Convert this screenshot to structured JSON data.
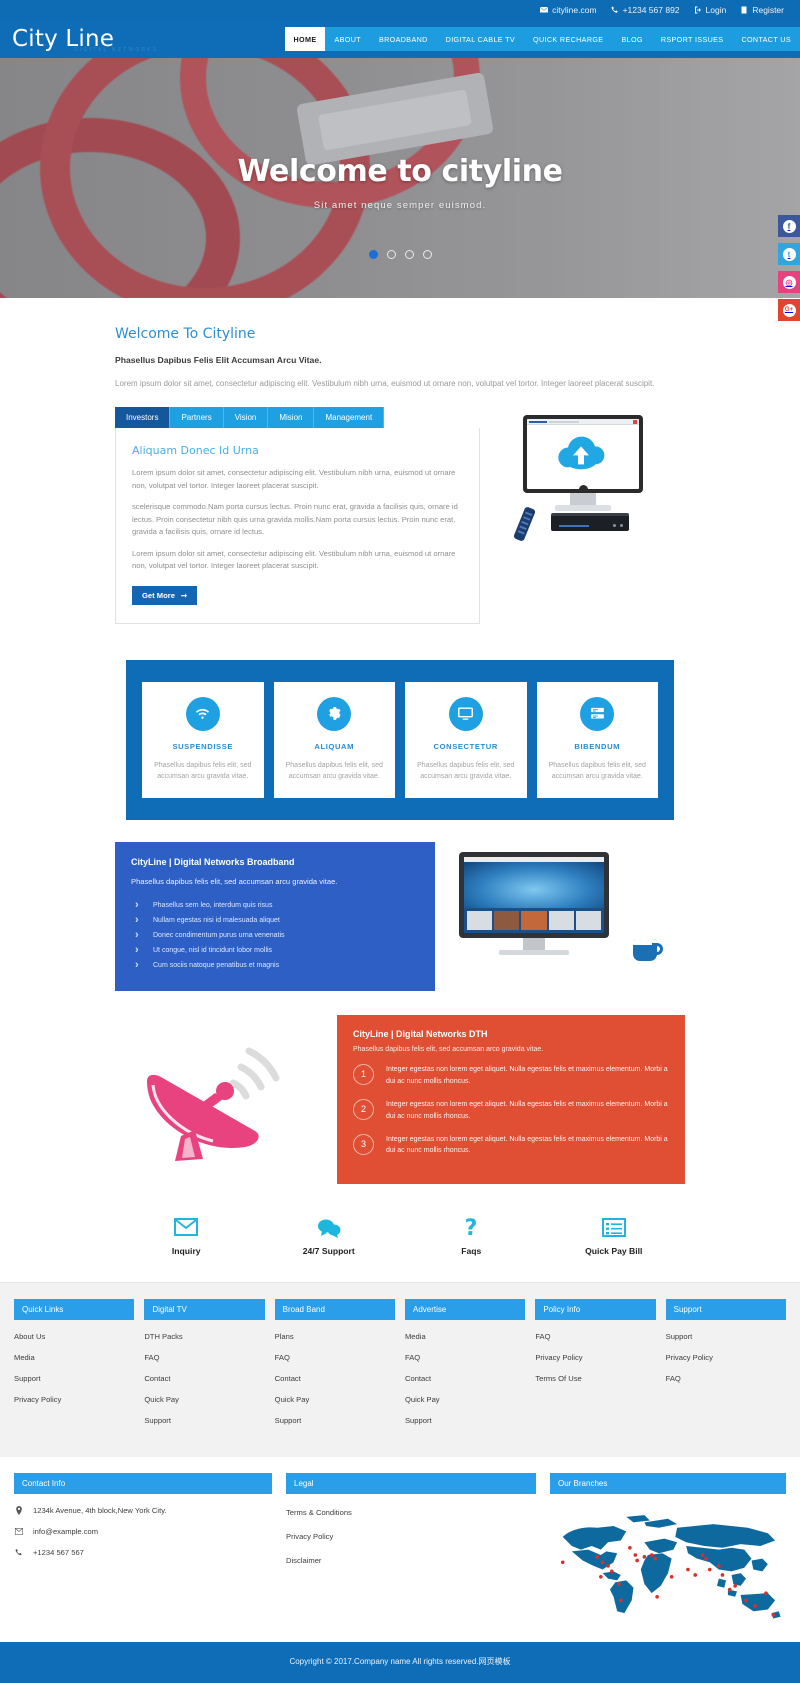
{
  "topbar": {
    "email": "cityline.com",
    "phone": "+1234 567 892",
    "login": "Login",
    "register": "Register"
  },
  "header": {
    "logo": "City Line",
    "logo_sub": "DIGITAL NETWORKS",
    "nav": [
      {
        "label": "HOME",
        "active": true
      },
      {
        "label": "ABOUT",
        "active": false
      },
      {
        "label": "BROADBAND",
        "active": false
      },
      {
        "label": "DIGITAL CABLE TV",
        "active": false
      },
      {
        "label": "QUICK RECHARGE",
        "active": false
      },
      {
        "label": "BLOG",
        "active": false
      },
      {
        "label": "RSPORT ISSUES",
        "active": false
      },
      {
        "label": "CONTACT US",
        "active": false
      }
    ]
  },
  "hero": {
    "title": "Welcome to cityline",
    "subtitle": "Sit amet neque semper euismod.",
    "dots": 4,
    "active_dot": 0
  },
  "social": [
    {
      "name": "facebook",
      "glyph": "f",
      "color": "#3a589b"
    },
    {
      "name": "twitter",
      "glyph": "t",
      "color": "#30a5e0"
    },
    {
      "name": "instagram",
      "glyph": "◎",
      "color": "#e8427e"
    },
    {
      "name": "googleplus",
      "glyph": "G+",
      "color": "#e2452f"
    }
  ],
  "welcome": {
    "heading": "Welcome To Cityline",
    "lead": "Phasellus Dapibus Felis Elit Accumsan Arcu Vitae.",
    "paragraph": "Lorem ipsum dolor sit amet, consectetur adipiscing elit. Vestibulum nibh urna, euismod ut ornare non, volutpat vel tortor. Integer laoreet placerat suscipit.",
    "tabs": [
      {
        "label": "Investors",
        "active": true
      },
      {
        "label": "Partners",
        "active": false
      },
      {
        "label": "Vision",
        "active": false
      },
      {
        "label": "Mision",
        "active": false
      },
      {
        "label": "Management",
        "active": false
      }
    ],
    "panel": {
      "title": "Aliquam Donec Id Urna",
      "p1": "Lorem ipsum dolor sit amet, consectetur adipiscing elit. Vestibulum nibh urna, euismod ut ornare non, volutpat vel tortor. Integer laoreet placerat suscipit.",
      "p2": "scelerisque commodo.Nam porta cursus lectus. Proin nunc erat, gravida a facilisis quis, ornare id lectus. Proin consectetur nibh quis urna gravida mollis.Nam porta cursus lectus. Proin nunc erat, gravida a facilisis quis, ornare id lectus.",
      "p3": "Lorem ipsum dolor sit amet, consectetur adipiscing elit. Vestibulum nibh urna, euismod ut ornare non, volutpat vel tortor. Integer laoreet placerat suscipit.",
      "button": "Get More"
    }
  },
  "services": [
    {
      "icon": "wifi-icon",
      "title": "SUSPENDISSE",
      "text": "Phasellus dapibus felis elit, sed accumsan arcu gravida vitae."
    },
    {
      "icon": "gear-icon",
      "title": "ALIQUAM",
      "text": "Phasellus dapibus felis elit, sed accumsan arcu gravida vitae."
    },
    {
      "icon": "monitor-icon",
      "title": "CONSECTETUR",
      "text": "Phasellus dapibus felis elit, sed accumsan arcu gravida vitae."
    },
    {
      "icon": "server-icon",
      "title": "BIBENDUM",
      "text": "Phasellus dapibus felis elit, sed accumsan arcu gravida vitae."
    }
  ],
  "broadband": {
    "title": "CityLine | Digital Networks Broadband",
    "subtitle": "Phasellus dapibus felis elit, sed accumsan arcu gravida vitae.",
    "items": [
      "Phasellus sem leo, interdum quis risus",
      "Nullam egestas nisi id malesuada aliquet",
      "Donec condimentum purus urna venenatis",
      "Ut congue, nisl id tincidunt lobor mollis",
      "Cum sociis natoque penatibus et magnis"
    ]
  },
  "dth": {
    "title": "CityLine | Digital Networks DTH",
    "subtitle": "Phasellus dapibus felis elit, sed accumsan arco gravida vitae.",
    "items": [
      {
        "num": "1",
        "text": "Integer egestas non lorem eget aliquet. Nulla egestas felis et maximus elementum. Morbi a dui ac nunc mollis rhoncus."
      },
      {
        "num": "2",
        "text": "Integer egestas non lorem eget aliquet. Nulla egestas felis et maximus elementum. Morbi a dui ac nunc mollis rhoncus."
      },
      {
        "num": "3",
        "text": "Integer egestas non lorem eget aliquet. Nulla egestas felis et maximus elementum. Morbi a dui ac nunc mollis rhoncus."
      }
    ]
  },
  "support": [
    {
      "icon": "envelope-icon",
      "label": "Inquiry"
    },
    {
      "icon": "chat-bubbles-icon",
      "label": "24/7 Support"
    },
    {
      "icon": "question-mark-icon",
      "label": "Faqs"
    },
    {
      "icon": "bill-list-icon",
      "label": "Quick Pay Bill"
    }
  ],
  "footer_links": [
    {
      "head": "Quick Links",
      "items": [
        "About Us",
        "Media",
        "Support",
        "Privacy Policy"
      ]
    },
    {
      "head": "Digital TV",
      "items": [
        "DTH Packs",
        "FAQ",
        "Contact",
        "Quick Pay",
        "Support"
      ]
    },
    {
      "head": "Broad Band",
      "items": [
        "Plans",
        "FAQ",
        "Contact",
        "Quick Pay",
        "Support"
      ]
    },
    {
      "head": "Advertise",
      "items": [
        "Media",
        "FAQ",
        "Contact",
        "Quick Pay",
        "Support"
      ]
    },
    {
      "head": "Policy Info",
      "items": [
        "FAQ",
        "Privacy Policy",
        "Terms Of Use"
      ]
    },
    {
      "head": "Support",
      "items": [
        "Support",
        "Privacy Policy",
        "FAQ"
      ]
    }
  ],
  "contact_info": {
    "head": "Contact Info",
    "address": "1234k Avenue, 4th block,New York City.",
    "email": "info@example.com",
    "phone": "+1234 567 567"
  },
  "legal": {
    "head": "Legal",
    "items": [
      "Terms & Conditions",
      "Privacy Policy",
      "Disclaimer"
    ]
  },
  "branches": {
    "head": "Our Branches"
  },
  "copyright": "Copyright © 2017.Company name All rights reserved.网页模板"
}
